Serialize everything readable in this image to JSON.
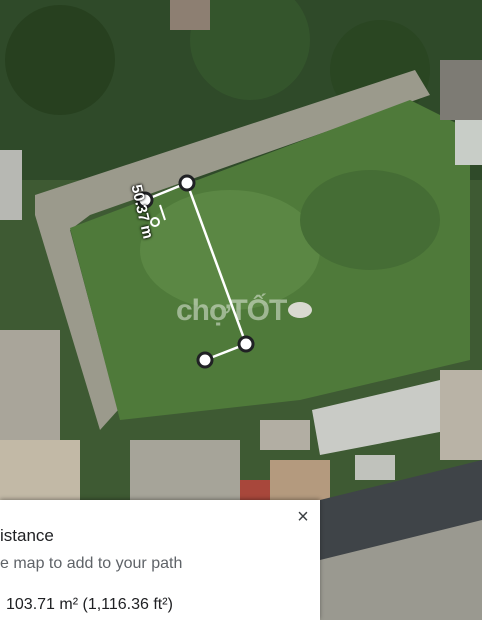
{
  "map": {
    "measure_label": "50.37 m",
    "watermark": "chợTỐT"
  },
  "panel": {
    "title": "istance",
    "hint": "e map to add to your path",
    "area": "103.71 m² (1,116.36 ft²)",
    "close_icon": "close-icon",
    "close_symbol": "×"
  },
  "colors": {
    "path_line": "#ffffff",
    "vertex_fill": "#ffffff",
    "vertex_stroke": "#202124"
  }
}
